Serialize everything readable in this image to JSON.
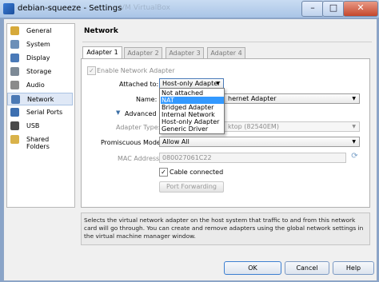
{
  "window": {
    "title": "debian-squeeze - Settings",
    "background_title": "VM VirtualBox",
    "minimize": "–",
    "maximize": "□",
    "close": "✕"
  },
  "sidebar": {
    "items": [
      {
        "label": "General",
        "icon": "general-icon",
        "color": "#d6a93a"
      },
      {
        "label": "System",
        "icon": "system-icon",
        "color": "#6c8fb8"
      },
      {
        "label": "Display",
        "icon": "display-icon",
        "color": "#4a7ab8"
      },
      {
        "label": "Storage",
        "icon": "storage-icon",
        "color": "#7d8a96"
      },
      {
        "label": "Audio",
        "icon": "audio-icon",
        "color": "#8b8b8b"
      },
      {
        "label": "Network",
        "icon": "network-icon",
        "color": "#4b79b4",
        "selected": true
      },
      {
        "label": "Serial Ports",
        "icon": "serial-ports-icon",
        "color": "#3d6fb0"
      },
      {
        "label": "USB",
        "icon": "usb-icon",
        "color": "#4a4a4a"
      },
      {
        "label": "Shared Folders",
        "icon": "shared-folders-icon",
        "color": "#d9b24a"
      }
    ]
  },
  "page": {
    "title": "Network",
    "tabs": [
      "Adapter 1",
      "Adapter 2",
      "Adapter 3",
      "Adapter 4"
    ],
    "enable_adapter_label": "Enable Network Adapter",
    "attached_to_label": "Attached to:",
    "attached_to_value": "Host-only Adapter",
    "name_label": "Name:",
    "name_value": "hernet Adapter",
    "advanced_label": "Advanced",
    "adapter_type_label": "Adapter Type:",
    "adapter_type_value": "ktop (82540EM)",
    "promiscuous_label": "Promiscuous Mode:",
    "promiscuous_value": "Allow All",
    "mac_label": "MAC Address:",
    "mac_value": "080027061C22",
    "cable_label": "Cable connected",
    "port_forwarding_label": "Port Forwarding",
    "dropdown_options": [
      "Not attached",
      "NAT",
      "Bridged Adapter",
      "Internal Network",
      "Host-only Adapter",
      "Generic Driver"
    ],
    "dropdown_highlighted": "NAT"
  },
  "info_text": "Selects the virtual network adapter on the host system that traffic to and from this network card will go through. You can create and remove adapters using the global network settings in the virtual machine manager window.",
  "buttons": {
    "ok": "OK",
    "cancel": "Cancel",
    "help": "Help"
  },
  "glyphs": {
    "check": "✓",
    "arrow_down": "▼",
    "triangle_down": "▼",
    "refresh": "⟳"
  },
  "colors": {
    "accent": "#3399ff",
    "selection_bg": "#dfe8f6"
  }
}
